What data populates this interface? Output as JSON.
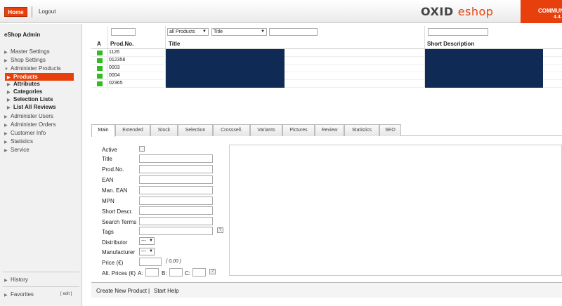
{
  "topbar": {
    "home_label": "Home",
    "logout_label": "Logout",
    "logo_oxid": "OXID",
    "logo_eshop": "eshop",
    "edition": "COMMUNITY",
    "version": "4.4."
  },
  "sidebar": {
    "title": "eShop Admin",
    "items": [
      {
        "label": "Master Settings"
      },
      {
        "label": "Shop Settings"
      },
      {
        "label": "Administer Products"
      },
      {
        "label": "Products"
      },
      {
        "label": "Attributes"
      },
      {
        "label": "Categories"
      },
      {
        "label": "Selection Lists"
      },
      {
        "label": "List All Reviews"
      },
      {
        "label": "Administer Users"
      },
      {
        "label": "Administer Orders"
      },
      {
        "label": "Customer Info"
      },
      {
        "label": "Statistics"
      },
      {
        "label": "Service"
      }
    ],
    "history_label": "History",
    "favorites_label": "Favorites",
    "edit_label": "[ edit ]"
  },
  "list": {
    "filter_category": "all Products",
    "filter_field": "Title",
    "col_active": "A",
    "col_prodno": "Prod.No.",
    "col_title": "Title",
    "col_short": "Short Description",
    "rows": [
      {
        "prodno": "1126"
      },
      {
        "prodno": "012356"
      },
      {
        "prodno": "0003"
      },
      {
        "prodno": "0004"
      },
      {
        "prodno": "02365"
      }
    ]
  },
  "tabs": [
    "Main",
    "Extended",
    "Stock",
    "Selection",
    "Crosssell.",
    "Variants",
    "Pictures",
    "Review",
    "Statistics",
    "SEO"
  ],
  "form": {
    "active_label": "Active",
    "title_label": "Title",
    "prodno_label": "Prod.No.",
    "ean_label": "EAN",
    "man_ean_label": "Man. EAN",
    "mpn_label": "MPN",
    "short_descr_label": "Short Descr.",
    "search_terms_label": "Search Terms",
    "tags_label": "Tags",
    "distributor_label": "Distributor",
    "distributor_value": "---",
    "manufacturer_label": "Manufacturer",
    "manufacturer_value": "---",
    "price_label": "Price (€)",
    "price_hint": "( 0,00 )",
    "alt_prices_label": "Alt. Prices (€)",
    "a_label": "A:",
    "b_label": "B:",
    "c_label": "C:",
    "help_glyph": "?"
  },
  "bottombar": {
    "create_label": "Create New Product",
    "separator": "|",
    "help_label": "Start Help"
  }
}
